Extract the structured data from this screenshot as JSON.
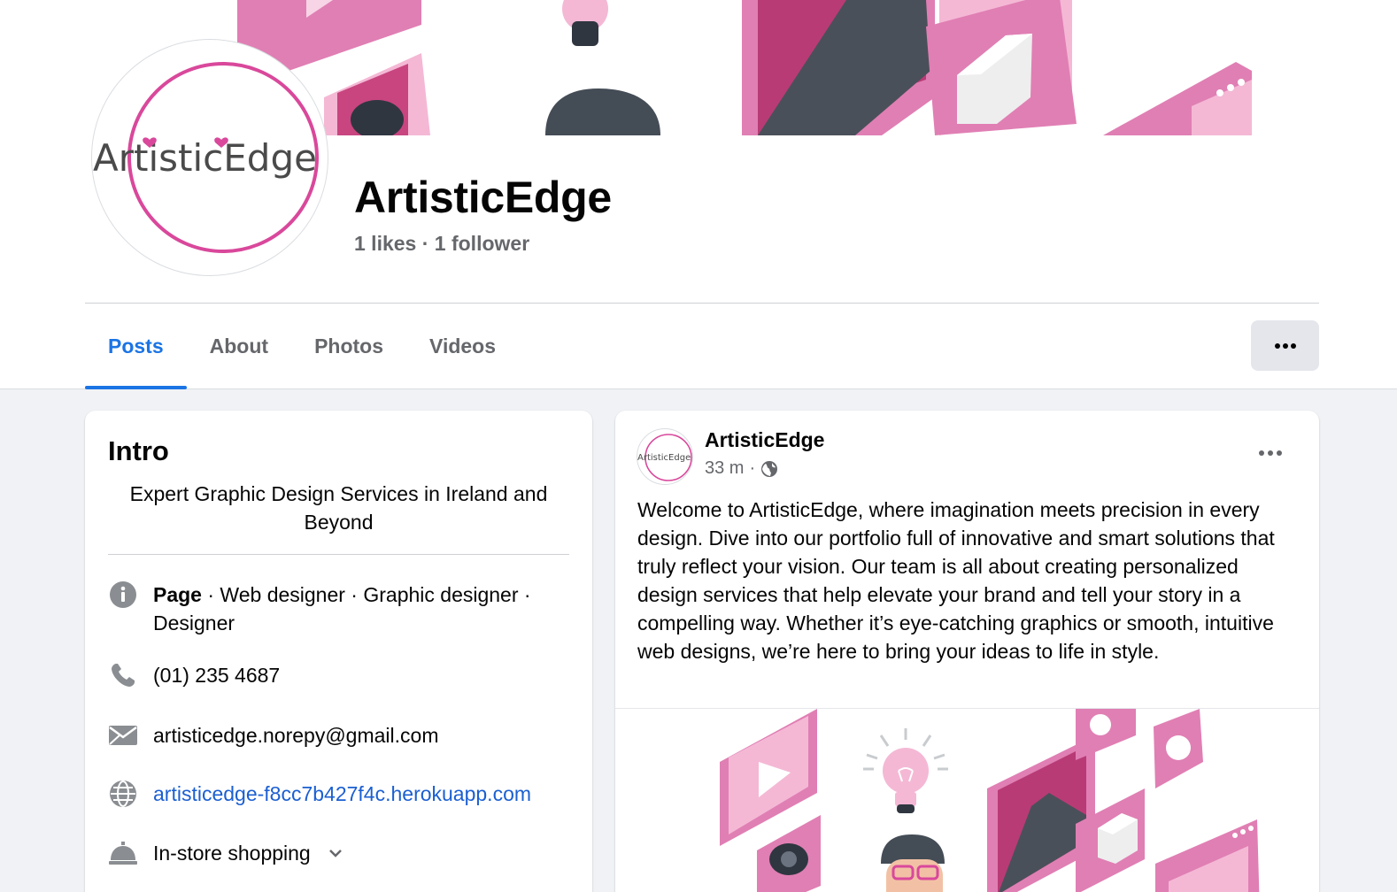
{
  "page": {
    "name": "ArtisticEdge",
    "logo_text": "ArtisticEdge",
    "likes": "1 likes",
    "followers": "1 follower",
    "stats_separator": "·"
  },
  "tabs": [
    {
      "label": "Posts",
      "active": true
    },
    {
      "label": "About",
      "active": false
    },
    {
      "label": "Photos",
      "active": false
    },
    {
      "label": "Videos",
      "active": false
    }
  ],
  "intro": {
    "title": "Intro",
    "bio": "Expert Graphic Design Services in Ireland and Beyond",
    "category_label": "Page",
    "categories": " · Web designer · Graphic designer · Designer",
    "phone": "(01) 235 4687",
    "email": "artisticedge.norepy@gmail.com",
    "website": "artisticedge-f8cc7b427f4c.herokuapp.com",
    "service": "In-store shopping"
  },
  "post": {
    "author": "ArtisticEdge",
    "time": "33 m",
    "separator": "·",
    "text": "Welcome to ArtisticEdge, where imagination meets precision in every design. Dive into our portfolio full of innovative and smart solutions that truly reflect your vision. Our team is all about creating personalized design services that help elevate your brand and tell your story in a compelling way. Whether it’s eye-catching graphics or smooth, intuitive web designs, we’re here to bring your ideas to life in style."
  },
  "icons": {
    "info": "info-icon",
    "phone": "phone-icon",
    "email": "mail-icon",
    "website": "globe-icon",
    "service": "service-bell-icon",
    "more": "more-dots-icon",
    "audience": "globe-icon",
    "expand": "chevron-down-icon"
  },
  "colors": {
    "accent": "#1b74e4",
    "brand_pink": "#d9489b",
    "link": "#1b5fd1",
    "muted_text": "#65676b",
    "background": "#f0f2f5"
  }
}
